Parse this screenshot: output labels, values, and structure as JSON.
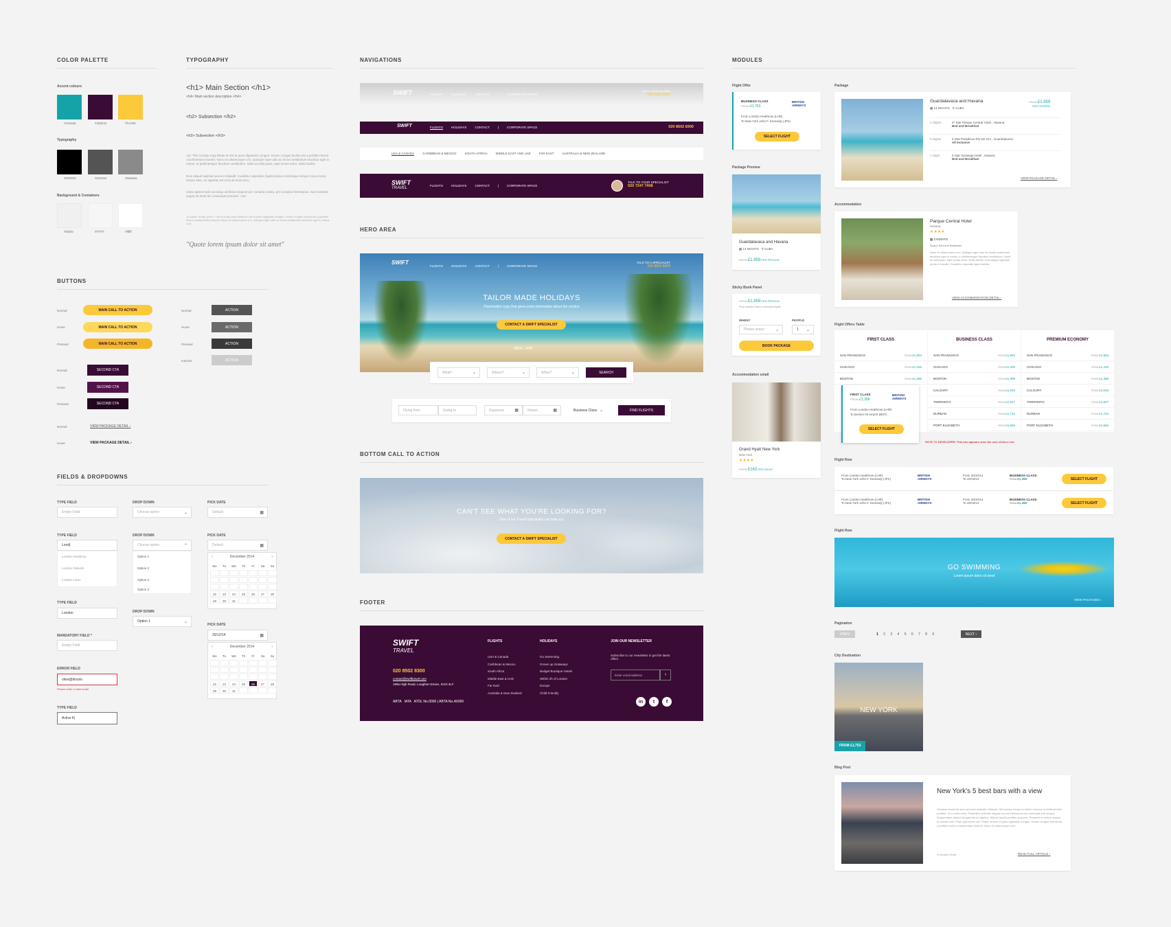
{
  "sections": {
    "palette": "COLOR PALETTE",
    "typography": "TYPOGRAPHY",
    "navigations": "NAVIGATIONS",
    "modules": "MODULES",
    "buttons": "BUTTONS",
    "fields": "FIELDS & DROPDOWNS",
    "hero": "HERO AREA",
    "bottom_cta": "BOTTOM CALL TO ACTION",
    "footer": "FOOTER"
  },
  "palette": {
    "accent_label": "Accent colours",
    "typography_label": "Typography",
    "bg_label": "Background & Containers",
    "accent": [
      "#16a3a8",
      "#3a0b34",
      "#fcc93b"
    ],
    "accent_codes": [
      "#16a3a8",
      "#3a0b34",
      "#fcc93b"
    ],
    "text": [
      "#000000",
      "#545454",
      "#8a8a8a"
    ],
    "text_codes": [
      "#000000",
      "#545454",
      "#8a8a8a"
    ],
    "bg": [
      "#f3f3f3",
      "#f7f7f7",
      "#ffffff"
    ],
    "bg_codes": [
      "#f3f3f3",
      "#f7f7f7",
      "#ffffff"
    ]
  },
  "typography": {
    "h1": "<h1> Main Section </h1>",
    "h4": "<h4> Main section description </h4>",
    "h2": "<h2> Subsection </h2>",
    "h3": "<h3> Subsection </h3>",
    "p1": "<p> This is body copy Etiam et nisi ut justo dignissim congue. Donec congue lacinia dui a porttitor lectus condimentum laoreet. Nunc eu ullamcorper orci. Quisque eget odio ac lectus vestibulum faucibus eget in metus. In pellentesque faucibus vestibulum. Nulla at nulla justo, eget luctus tortor. Nulla facilisi.",
    "p2": "Duis aliquet egestas purus in blandit. Curabitur vulputate, ligula lacinia scelerisque tempor, lacus lacus ornare ante, ac egestas est urna sit amet arcu.",
    "p3": "Class aptent taciti sociosqu ad litora torquent per conubia nostra, per inceptos himenaeos. Sed molestie augue sit amet leo consequat posuere. </p>",
    "p4": "<p class=\"small_print\"> This is body copy Etiam et nisi ut justo dignissim congue. Donec congue lacinia dui a porttitor lectus condimentum laoreet. Nunc eu ullamcorper orci. Quisque eget odio ac lectus vestibulum faucibus eget in metus. </p>",
    "quote": "\"Quote lorem ipsum dolor sit amet\""
  },
  "buttons": {
    "normal": "Normal",
    "hover": "Hover",
    "pressed": "Pressed",
    "inactive": "Inactive",
    "main_cta": "MAIN CALL TO ACTION",
    "action": "ACTION",
    "second_cta": "SECOND CTA",
    "view_package": "VIEW PACKAGE DETAIL"
  },
  "fields": {
    "type_field": "TYPE FIELD",
    "drop_down": "DROP DOWN",
    "pick_date": "PICK DATE",
    "mandatory": "MANDATORY FIELD *",
    "error_field": "ERROR FIELD",
    "empty": "Empty Field",
    "choose": "Choose option",
    "default": "Default",
    "typed": "Lond|",
    "suggestions": [
      "London Heathrow",
      "London Gatwick",
      "London Luton"
    ],
    "options": [
      "Option 1",
      "Option 2",
      "Option 3",
      "Option 3"
    ],
    "london": "London",
    "option1": "Option 1",
    "error_value": "olive@tkrsolo",
    "error_msg": "Please enter a valid email",
    "active_value": "Active fi|",
    "date_value": "26/12/14",
    "month": "December 2014",
    "days": [
      "Mo",
      "Tu",
      "We",
      "Th",
      "Fr",
      "Sa",
      "Su"
    ],
    "dates": [
      "",
      "",
      "",
      "",
      "",
      "",
      "",
      "",
      "",
      "",
      "",
      "",
      "",
      "",
      "",
      "",
      "",
      "",
      "",
      "",
      "",
      "22",
      "23",
      "24",
      "25",
      "26",
      "27",
      "28",
      "29",
      "30",
      "31",
      "",
      "",
      "",
      ""
    ]
  },
  "nav": {
    "brand": "SWIFT",
    "brand2": "TRAVEL",
    "items": [
      "FLIGHTS",
      "HOLIDAYS",
      "CONTACT",
      "|",
      "CORPORATE SPACE"
    ],
    "talk": "Talk to a Swift specialist",
    "phone": "020 8502 8300",
    "sub_items": [
      "USA & CANADA",
      "CARIBBEAN & MEXICO",
      "SOUTH AFRICA",
      "MIDDLE EAST AND UAE",
      "FAR EAST",
      "AUSTRALIA & NEW ZEALAND"
    ],
    "talk_upper": "TALK TO YOUR SPECIALIST",
    "phone2": "020 7247 7408"
  },
  "hero": {
    "talk": "TALK TO A SPECIALIST",
    "phone": "020 8502 8300",
    "title": "TAILOR MADE HOLIDAYS",
    "subtitle": "Placeholder copy that gives extra information about the section",
    "cta": "CONTACT A SWIFT SPECIALIST",
    "what": "What?",
    "where": "Where?",
    "when": "When?",
    "search": "SEARCH",
    "flying_from": "Flying from",
    "going_to": "Going to",
    "departure": "Departure",
    "return": "Return",
    "class": "Business Class",
    "find": "FIND FLIGHTS"
  },
  "bottom_cta": {
    "title": "CAN'T SEE WHAT YOU'RE LOOKING FOR?",
    "sub": "One of our Travel Specialists can help you",
    "cta": "CONTACT A SWIFT SPECIALIST"
  },
  "footer": {
    "phone": "020 8502 8300",
    "email": "contact@swifttravel.com",
    "address": "199a High Road, Loughton Essex, IG10 4LF",
    "flights_title": "FLIGHTS",
    "flights": [
      "USA & Canada",
      "Caribbean & Mexico",
      "South Africa",
      "Middle East & UAE",
      "Far East",
      "Australia & New Zealand"
    ],
    "holidays_title": "HOLIDAYS",
    "holidays": [
      "Go Swimming",
      "Grown up Getaways",
      "Budget Boutique Hotels",
      "Within 3h of London",
      "Europe",
      "Child Friendly"
    ],
    "news_title": "JOIN OUR NEWSLETTER",
    "news_text": "Subscribe to our newsletter to get the latest offers",
    "email_ph": "Enter email address",
    "abta": "ABTA",
    "iata": "IATA",
    "legal": "ATOL No.0000  |  ABTA No.A0000"
  },
  "modules": {
    "flight_offer": "Flight Offer",
    "business": "BUSINESS CLASS",
    "from": "FROM",
    "price_1753": "£1,753",
    "from_lhr": "From London Heathrow (LHR)",
    "to_jfk": "To New York John F. Kennedy (JFK)",
    "select_flight": "SELECT FLIGHT",
    "ba": "BRITISH AIRWAYS",
    "package_preview": "Package Preview",
    "pkg_name": "Guardalavaca and Havana",
    "nights": "14 NIGHTS",
    "cuba": "CUBA",
    "price_1959": "£1,959",
    "per_person": "PER PERSON",
    "sticky": "Sticky Book Panel",
    "price_note": "Price Includes Return scheduled flights",
    "when": "WHEN?",
    "people": "PEOPLE",
    "please_select": "Please select",
    "one": "1",
    "book": "BOOK PACKAGE",
    "acc_small": "Accommodation small",
    "hyatt": "Grand Hyatt New York",
    "ny": "New York",
    "price_163": "£163",
    "per_night": "PER NIGHT",
    "package": "Package",
    "itin": [
      {
        "n": "4 Nights",
        "t": "4* Star Parque Central Hotel , Havana",
        "b": "Bed and Breakfast"
      },
      {
        "n": "9 Nights",
        "t": "5 Star Paradisus Rio De Oro , Guardalavaca",
        "b": "All Inclusive"
      },
      {
        "n": "1 Night",
        "t": "5 Star Saratoga Hotel , Havana",
        "b": "Bed and Breakfast"
      }
    ],
    "view_pkg": "VIEW PACKAGE DETAIL",
    "accommodation": "Accommodation",
    "hotel": "Parque Central Hotel",
    "havana": "Havana",
    "hotel_nights": "3 NIGHTS",
    "board": "Board: Bed and Breakfast",
    "hotel_desc": "Nunc eu ullamcorper orci. Quisque eget odio ac lectus vestibulum faucibus eget in metus. In pellentesque faucibus vestibulum. Nulla at nulla justo, eget luctus tortor. Nulla facilisi. Duis aliquet egestas purus in blandit. Curabitur vulputate ligula lacinia.",
    "view_acc": "VIEW ACCOMMODATION DETAIL",
    "table_title": "Flight Offers Table",
    "cols": [
      "FIRST CLASS",
      "BUSINESS CLASS",
      "PREMIUM ECONOMY"
    ],
    "rows1": [
      [
        "SAN FRANCISCO",
        "£1,853"
      ],
      [
        "CHICAGO",
        "£1,425"
      ],
      [
        "BOSTON",
        "£1,398"
      ]
    ],
    "rows2": [
      [
        "SAN FRANCISCO",
        "£1,853"
      ],
      [
        "CHICAGO",
        "£1,425"
      ],
      [
        "BOSTON",
        "£1,398"
      ],
      [
        "CALGARY",
        "£1,818"
      ],
      [
        "TORRONTO",
        "£1,647"
      ],
      [
        "DURBAN",
        "£1,734"
      ],
      [
        "PORT ELIZABETH",
        "£1,566"
      ]
    ],
    "popup_class": "FIRST CLASS",
    "popup_price": "£1,398",
    "popup_to": "To Boston Int Airport (BST)",
    "dev_note": "NOTE TO DEVELOPER: This box appears once the user clicks a row",
    "flight_row": "Flight Row",
    "date_from": "From 20/10/14",
    "date_to": "To 20/10/14",
    "price_1398": "£1,398",
    "flight_row2": "Flight Row",
    "go_swim": "GO SWIMMING",
    "lorem": "Lorem ipsum dolor sit amet",
    "view_packages": "VIEW PACKAGES",
    "pagination": "Pagination",
    "prev": "PREV",
    "pages": [
      "1",
      "2",
      "3",
      "4",
      "5",
      "6",
      "7",
      "8",
      "9"
    ],
    "next": "NEXT",
    "city": "City Destination",
    "newyork": "NEW YORK",
    "city_price": "FROM £1,753",
    "blog": "Blog Post",
    "blog_title": "New York's 5 best bars with a view",
    "blog_text": "Vivamus hendrerit arcu sed erat molestie vehicula. Sed auctor neque eu tellus rhoncus ut eleifend nibh porttitor. Ut in nulla enim. Phasellus molestie magna non est bibendum non venenatis nisl tempor. Suspendisse dictum feugiat nisl ut dapibus. Mauris iaculis porttitor posuere. Praesent id metus massa, ut blandit odio. Proin quis tortor orci. Etiam at risus et justo dignissim congue. Donec congue lacinia dui, a porttitor lectus condimentum laoreet. Nunc eu ullamcorper orci.",
    "read_time": "3 minutes Read",
    "read_full": "READ FULL ARTICLE"
  }
}
